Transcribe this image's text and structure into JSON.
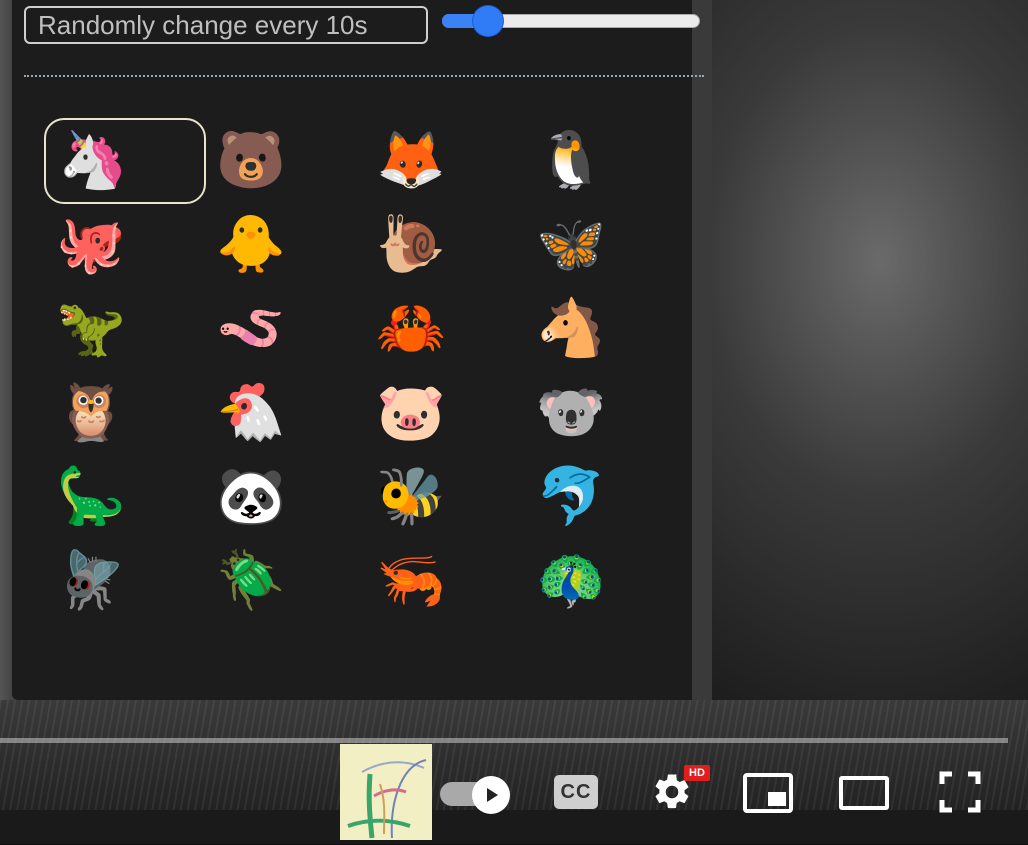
{
  "header": {
    "randomize_label": "Randomly change every 10s",
    "interval_slider_level": 0.18
  },
  "emoji_grid": [
    {
      "emoji": "🦄",
      "name": "unicorn",
      "selected": true
    },
    {
      "emoji": "🐻",
      "name": "bear",
      "selected": false
    },
    {
      "emoji": "🦊",
      "name": "fox",
      "selected": false
    },
    {
      "emoji": "🐧",
      "name": "penguin",
      "selected": false
    },
    {
      "emoji": "🐙",
      "name": "octopus",
      "selected": false
    },
    {
      "emoji": "🐥",
      "name": "chick",
      "selected": false
    },
    {
      "emoji": "🐌",
      "name": "snail",
      "selected": false
    },
    {
      "emoji": "🦋",
      "name": "butterfly",
      "selected": false
    },
    {
      "emoji": "🦖",
      "name": "t-rex",
      "selected": false
    },
    {
      "emoji": "🪱",
      "name": "worm",
      "selected": false
    },
    {
      "emoji": "🦀",
      "name": "crab",
      "selected": false
    },
    {
      "emoji": "🐴",
      "name": "horse",
      "selected": false
    },
    {
      "emoji": "🦉",
      "name": "owl",
      "selected": false
    },
    {
      "emoji": "🐔",
      "name": "chicken",
      "selected": false
    },
    {
      "emoji": "🐷",
      "name": "pig",
      "selected": false
    },
    {
      "emoji": "🐨",
      "name": "koala",
      "selected": false
    },
    {
      "emoji": "🦕",
      "name": "sauropod",
      "selected": false
    },
    {
      "emoji": "🐼",
      "name": "panda",
      "selected": false
    },
    {
      "emoji": "🐝",
      "name": "bee",
      "selected": false
    },
    {
      "emoji": "🐬",
      "name": "dolphin",
      "selected": false
    },
    {
      "emoji": "🪰",
      "name": "fly",
      "selected": false
    },
    {
      "emoji": "🪲",
      "name": "beetle",
      "selected": false
    },
    {
      "emoji": "🦐",
      "name": "shrimp",
      "selected": false
    },
    {
      "emoji": "🦚",
      "name": "peacock",
      "selected": false
    }
  ],
  "player_controls": {
    "cc_label": "CC",
    "hd_badge": "HD",
    "icons": [
      "logo-icon",
      "autoplay-toggle-icon",
      "captions-icon",
      "settings-gear-icon",
      "miniplayer-icon",
      "theater-mode-icon",
      "fullscreen-icon"
    ]
  },
  "colors": {
    "panel_bg": "#1c1c1d",
    "slider_accent": "#2f7cf6",
    "hd_badge": "#e01e1e",
    "selected_border": "#e8e4c8"
  }
}
